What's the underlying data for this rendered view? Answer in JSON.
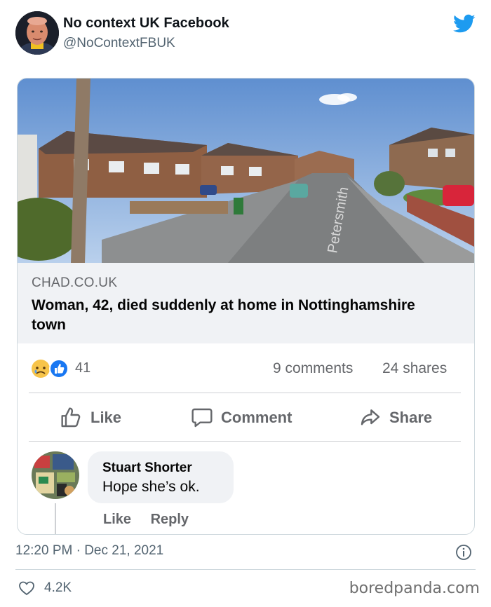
{
  "tweet": {
    "author_name": "No context UK Facebook",
    "author_handle": "@NoContextFBUK",
    "timestamp": "12:20 PM · Dec 21, 2021",
    "like_count": "4.2K"
  },
  "facebook_post": {
    "link": {
      "source": "CHAD.CO.UK",
      "title": "Woman, 42, died suddenly at home in Nottinghamshire town"
    },
    "photo": {
      "street_sign": "Petersmith"
    },
    "reactions": {
      "icons": [
        "sad-reaction-icon",
        "like-reaction-icon"
      ],
      "count": "41",
      "comments": "9 comments",
      "shares": "24 shares"
    },
    "actions": {
      "like": "Like",
      "comment": "Comment",
      "share": "Share"
    },
    "comment": {
      "author": "Stuart Shorter",
      "text": "Hope she’s ok.",
      "like_label": "Like",
      "reply_label": "Reply"
    }
  },
  "watermark": "boredpanda.com",
  "colors": {
    "twitter_blue": "#1d9bf0",
    "facebook_blue": "#1877f2",
    "muted_gray": "#65676b"
  }
}
